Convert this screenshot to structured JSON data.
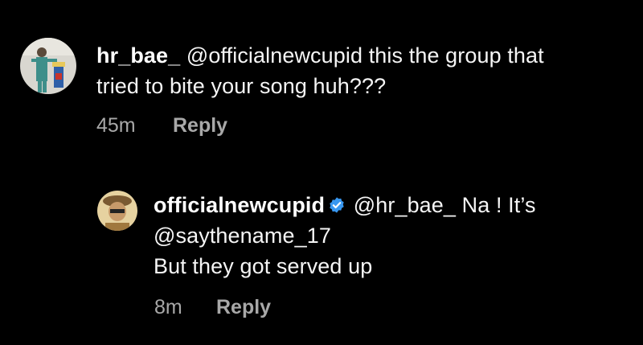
{
  "comments": [
    {
      "username": "hr_bae_",
      "mention": "@officialnewcupid",
      "text_line1_rest": " this the group that",
      "text_line2": "tried to bite your song huh???",
      "time": "45m",
      "reply_label": "Reply",
      "avatar_icon": "user-photo-icon"
    }
  ],
  "replies": [
    {
      "username": "officialnewcupid",
      "verified_icon": "verified-badge-icon",
      "verified_color": "#3897f0",
      "mention": "@hr_bae_",
      "text_line1_rest": " Na ! It’s",
      "text_line2": "@saythename_17",
      "text_line3": "But they got served up",
      "time": "8m",
      "reply_label": "Reply",
      "avatar_icon": "user-photo-icon"
    }
  ]
}
